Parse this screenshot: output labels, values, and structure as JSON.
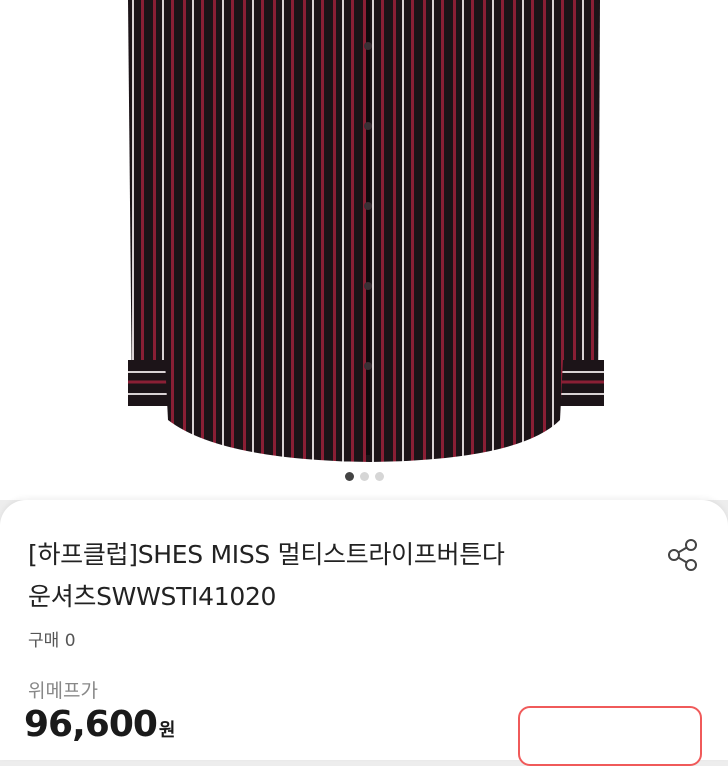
{
  "product": {
    "title_line1": "[하프클럽]SHES MISS 멀티스트라이프버튼다",
    "title_line2": "운셔츠SWWSTI41020",
    "purchase_label": "구매",
    "purchase_count": "0",
    "price_label": "위메프가",
    "price": "96,600",
    "price_unit": "원"
  },
  "gallery": {
    "image_alt": "striped-shirt-image",
    "total_images": 3,
    "active_index": 0
  },
  "icons": {
    "share": "share-icon"
  },
  "colors": {
    "shirt_base": "#1c1418",
    "stripe_red": "#8a1f35",
    "stripe_white": "#d9d2d4",
    "accent": "#f05a5a"
  }
}
